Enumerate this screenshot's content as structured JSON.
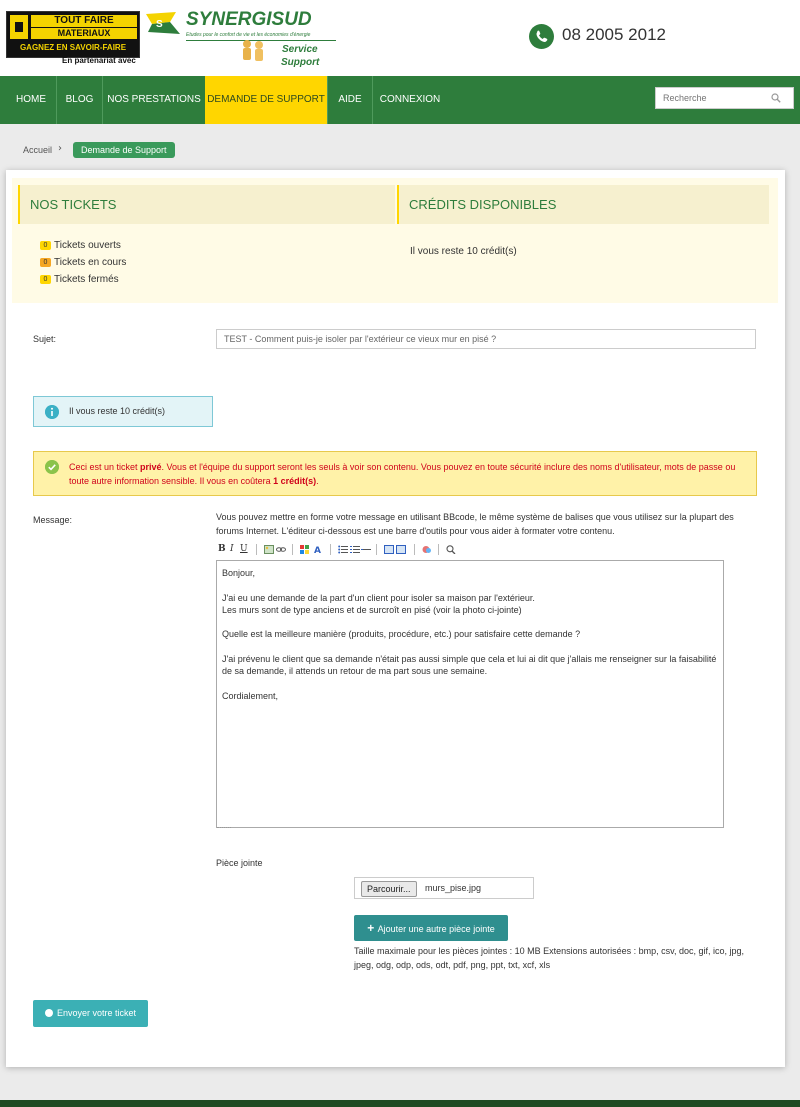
{
  "header": {
    "partner_logo": {
      "line1": "TOUT FAIRE",
      "line2": "MATERIAUX",
      "line3": "GAGNEZ EN SAVOIR-FAIRE",
      "caption": "En partenariat avec"
    },
    "brand_logo": {
      "name": "SYNERGISUD",
      "tagline": "Etudes pour le confort de vie et les économies d'énergie",
      "service": "Service",
      "support": "Support"
    },
    "phone": "08 2005 2012"
  },
  "nav": {
    "items": [
      {
        "label": "HOME"
      },
      {
        "label": "BLOG"
      },
      {
        "label": "NOS PRESTATIONS"
      },
      {
        "label": "DEMANDE DE SUPPORT",
        "active": true
      },
      {
        "label": "AIDE"
      },
      {
        "label": "CONNEXION"
      }
    ],
    "search_placeholder": "Recherche"
  },
  "breadcrumb": {
    "home": "Accueil",
    "current": "Demande de Support"
  },
  "tickets_panel": {
    "title": "NOS TICKETS",
    "items": [
      {
        "count": "0",
        "label": "Tickets ouverts"
      },
      {
        "count": "0",
        "label": "Tickets en cours"
      },
      {
        "count": "0",
        "label": "Tickets fermés"
      }
    ]
  },
  "credits_panel": {
    "title": "CRÉDITS DISPONIBLES",
    "text": "Il vous reste 10 crédit(s)"
  },
  "form": {
    "subject_label": "Sujet:",
    "subject_value": "TEST - Comment puis-je isoler par l'extérieur ce vieux mur en pisé ?",
    "credit_notice": "Il vous reste 10 crédit(s)",
    "private_notice": {
      "before": "Ceci est un ticket ",
      "bold1": "privé",
      "middle": ". Vous et l'équipe du support seront les seuls à voir son contenu. Vous pouvez en toute sécurité inclure des noms d'utilisateur, mots de passe ou toute autre information sensible. Il vous en coûtera ",
      "bold2": "1 crédit(s)",
      "after": "."
    },
    "message_label": "Message:",
    "message_help": "Vous pouvez mettre en forme votre message en utilisant BBcode, le même système de balises que vous utilisez sur la plupart des forums Internet. L'éditeur ci-dessous est une barre d'outils pour vous aider à formater votre contenu.",
    "toolbar": {
      "bold": "B",
      "italic": "I",
      "underline": "U"
    },
    "message_value": "Bonjour,\n\nJ'ai eu une demande de la part d'un client pour isoler sa maison par l'extérieur.\nLes murs sont de type anciens et de surcroît en pisé (voir la photo ci-jointe)\n\nQuelle est la meilleure manière (produits, procédure, etc.) pour satisfaire cette demande ?\n\nJ'ai prévenu le client que sa demande n'était pas aussi simple que cela et lui ai dit que j'allais me renseigner sur la faisabilité de sa demande, il attends un retour de ma part sous une semaine.\n\nCordialement,",
    "attachment_label": "Pièce jointe",
    "browse_label": "Parcourir...",
    "file_name": "murs_pise.jpg",
    "add_attachment_label": "Ajouter une autre pièce jointe",
    "attachment_help": "Taille maximale pour les pièces jointes : 10 MB Extensions autorisées : bmp, csv, doc, gif, ico, jpg, jpeg, odg, odp, ods, odt, pdf, png, ppt, txt, xcf, xls",
    "submit_label": "Envoyer votre ticket"
  },
  "colors": {
    "brand_green": "#2e7d3c",
    "nav_active": "#ffd600",
    "accent_teal": "#3bb0b5"
  }
}
